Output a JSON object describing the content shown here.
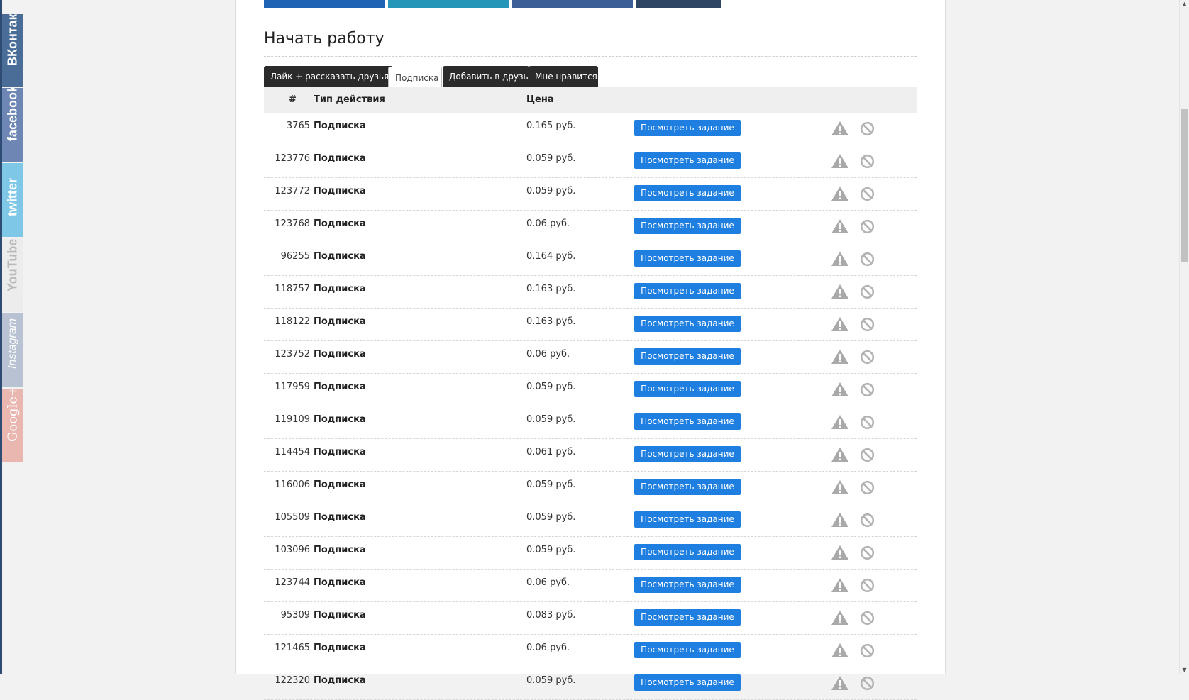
{
  "social": {
    "vk": "ВКонтакте",
    "facebook": "facebook",
    "twitter": "twitter",
    "youtube": "YouTube",
    "instagram": "Instagram",
    "googleplus": "Google+"
  },
  "page_title": "Начать работу",
  "tabs": [
    {
      "label": "Лайк + рассказать друзьям",
      "active": false
    },
    {
      "label": "Подписка",
      "active": true
    },
    {
      "label": "Добавить в друзья",
      "active": false
    },
    {
      "label": "Мне нравится",
      "active": false
    }
  ],
  "table": {
    "headers": {
      "num": "#",
      "type": "Тип действия",
      "price": "Цена"
    },
    "button_label": "Посмотреть задание",
    "rows": [
      {
        "id": "3765",
        "type": "Подписка",
        "price": "0.165 руб."
      },
      {
        "id": "123776",
        "type": "Подписка",
        "price": "0.059 руб."
      },
      {
        "id": "123772",
        "type": "Подписка",
        "price": "0.059 руб."
      },
      {
        "id": "123768",
        "type": "Подписка",
        "price": "0.06 руб."
      },
      {
        "id": "96255",
        "type": "Подписка",
        "price": "0.164 руб."
      },
      {
        "id": "118757",
        "type": "Подписка",
        "price": "0.163 руб."
      },
      {
        "id": "118122",
        "type": "Подписка",
        "price": "0.163 руб."
      },
      {
        "id": "123752",
        "type": "Подписка",
        "price": "0.06 руб."
      },
      {
        "id": "117959",
        "type": "Подписка",
        "price": "0.059 руб."
      },
      {
        "id": "119109",
        "type": "Подписка",
        "price": "0.059 руб."
      },
      {
        "id": "114454",
        "type": "Подписка",
        "price": "0.061 руб."
      },
      {
        "id": "116006",
        "type": "Подписка",
        "price": "0.059 руб."
      },
      {
        "id": "105509",
        "type": "Подписка",
        "price": "0.059 руб."
      },
      {
        "id": "103096",
        "type": "Подписка",
        "price": "0.059 руб."
      },
      {
        "id": "123744",
        "type": "Подписка",
        "price": "0.06 руб."
      },
      {
        "id": "95309",
        "type": "Подписка",
        "price": "0.083 руб."
      },
      {
        "id": "121465",
        "type": "Подписка",
        "price": "0.06 руб."
      },
      {
        "id": "122320",
        "type": "Подписка",
        "price": "0.059 руб."
      }
    ]
  },
  "icons": {
    "warning": "warning-icon",
    "block": "block-icon"
  },
  "colors": {
    "button": "#1f7fe0",
    "tab_dark": "#2b2b2b",
    "header_bg": "#efefef"
  }
}
